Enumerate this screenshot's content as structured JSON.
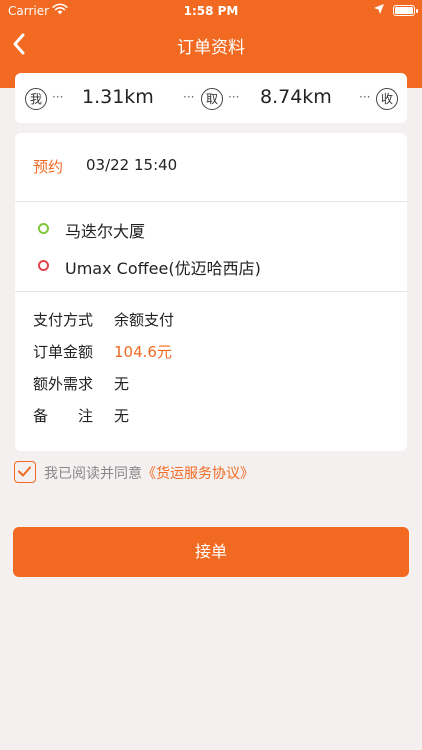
{
  "status_bar": {
    "carrier": "Carrier",
    "time": "1:58 PM",
    "icons": [
      "wifi-icon",
      "location-arrow-icon",
      "battery-icon"
    ]
  },
  "nav": {
    "title": "订单资料",
    "back_icon": "chevron-left-icon"
  },
  "distance": {
    "me_label": "我",
    "pickup_label": "取",
    "dropoff_label": "收",
    "to_pickup": "1.31km",
    "to_dropoff": "8.74km",
    "dots": "···"
  },
  "reservation": {
    "label": "预约",
    "time": "03/22 15:40"
  },
  "route": {
    "pickup_address": "马迭尔大厦",
    "dropoff_address": "Umax Coffee(优迈哈西店)"
  },
  "order_info": {
    "payment_label": "支付方式",
    "payment_value": "余额支付",
    "amount_label": "订单金额",
    "amount_value": "104.6元",
    "extra_label": "额外需求",
    "extra_value": "无",
    "note_label": "备　　注",
    "note_value": "无"
  },
  "agreement": {
    "checked": true,
    "prefix": "我已阅读并同意",
    "link": "《货运服务协议》"
  },
  "actions": {
    "accept_label": "接单"
  },
  "colors": {
    "accent": "#f26a22",
    "background": "#f4f0ef",
    "pickup_dot": "#7ec83a",
    "dropoff_dot": "#e0464b"
  }
}
